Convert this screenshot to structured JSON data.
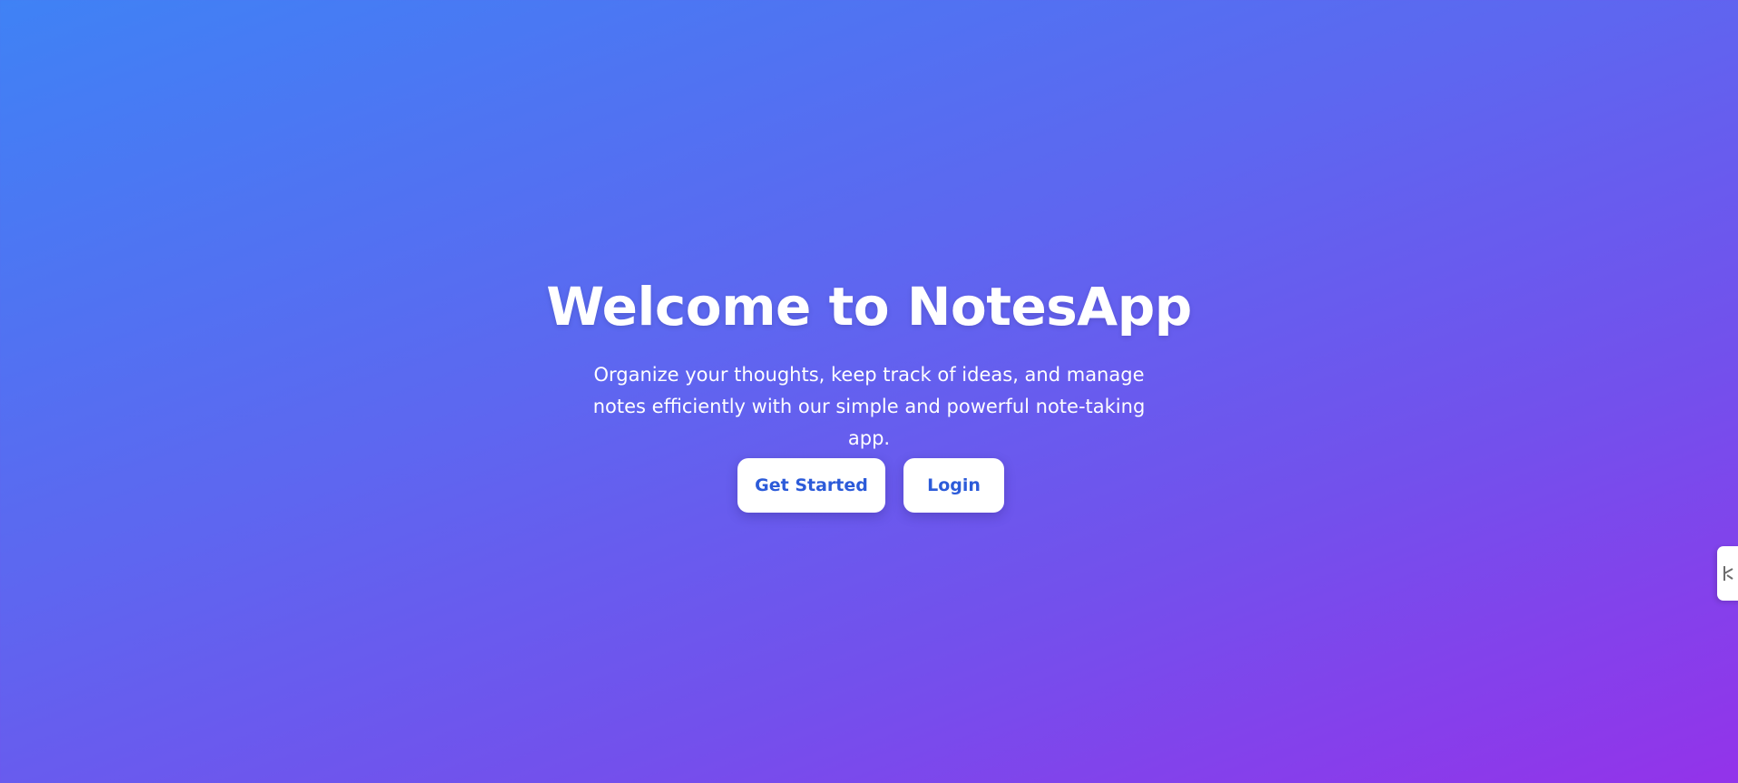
{
  "hero": {
    "title": "Welcome to NotesApp",
    "subtitle": "Organize your thoughts, keep track of ideas, and manage notes efficiently with our simple and powerful note-taking app."
  },
  "actions": {
    "get_started_label": "Get Started",
    "login_label": "Login"
  },
  "side_tab": {
    "icon": "resize-handle-icon"
  },
  "colors": {
    "gradient_start": "#3f82f5",
    "gradient_end": "#9333ea",
    "button_background": "#ffffff",
    "button_text": "#2c5bd9",
    "text": "#ffffff"
  }
}
